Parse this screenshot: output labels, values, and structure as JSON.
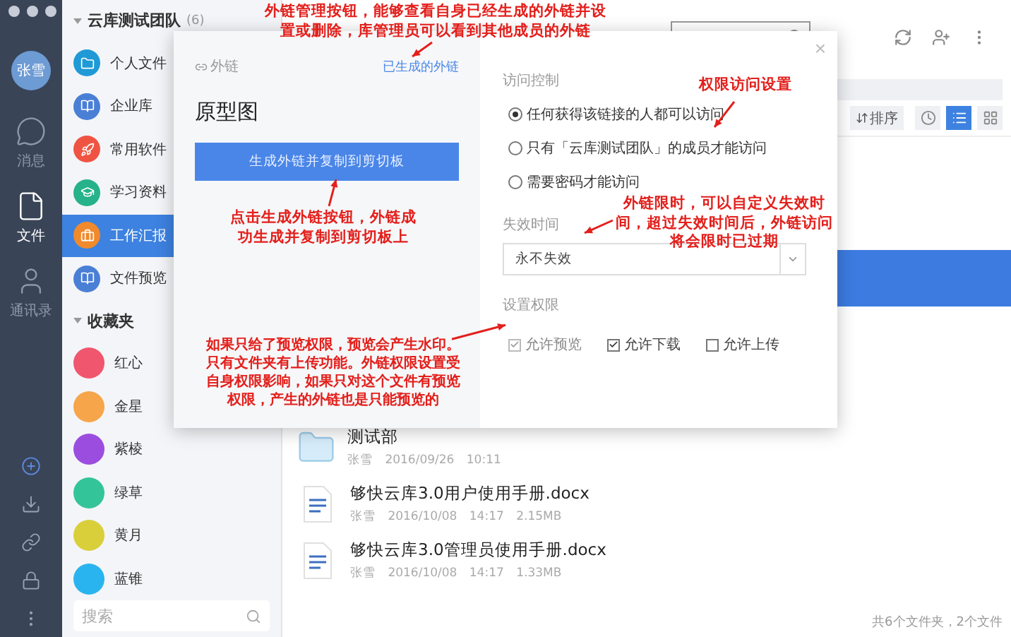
{
  "nav": {
    "avatar": "张雪",
    "items": [
      {
        "kind": "message",
        "label": "消息",
        "selected": false
      },
      {
        "kind": "file",
        "label": "文件",
        "selected": true
      },
      {
        "kind": "contacts",
        "label": "通讯录",
        "selected": false
      }
    ],
    "tools": [
      {
        "kind": "add"
      },
      {
        "kind": "download"
      },
      {
        "kind": "link"
      },
      {
        "kind": "lock"
      },
      {
        "kind": "more"
      }
    ]
  },
  "sidebar": {
    "team": {
      "name": "云库测试团队",
      "count": "(6)",
      "expanded": true
    },
    "libraries": [
      {
        "label": "个人文件",
        "color": "#1f9ad6",
        "kind": "folder",
        "selected": false
      },
      {
        "label": "企业库",
        "color": "#4a7fd6",
        "kind": "book",
        "selected": false
      },
      {
        "label": "常用软件",
        "color": "#ef5443",
        "kind": "rocket",
        "selected": false
      },
      {
        "label": "学习资料",
        "color": "#26b28a",
        "kind": "cap",
        "selected": false
      },
      {
        "label": "工作汇报",
        "color": "#f08a2c",
        "kind": "bag",
        "selected": true
      },
      {
        "label": "文件预览",
        "color": "#4a7fd6",
        "kind": "book",
        "selected": false
      }
    ],
    "favorites_title": "收藏夹",
    "favorites_expanded": true,
    "favorites": [
      {
        "label": "红心",
        "color": "#f0566e"
      },
      {
        "label": "金星",
        "color": "#f7a54a"
      },
      {
        "label": "紫棱",
        "color": "#9b4de0"
      },
      {
        "label": "绿草",
        "color": "#33c49a"
      },
      {
        "label": "黄月",
        "color": "#d9cf3a"
      },
      {
        "label": "蓝锥",
        "color": "#2ab4ef"
      }
    ],
    "search": {
      "placeholder": "搜索"
    }
  },
  "toolbar": {
    "sort": "排序",
    "views": [
      {
        "kind": "time",
        "selected": false
      },
      {
        "kind": "list",
        "selected": true
      },
      {
        "kind": "grid",
        "selected": false
      }
    ]
  },
  "files": [
    {
      "selected": false
    },
    {
      "selected": false
    },
    {
      "selected": true
    },
    {
      "selected": false
    },
    {
      "selected": false
    },
    {
      "selected": false,
      "kind": "folder",
      "name": "测试部",
      "owner": "张雪",
      "date": "2016/09/26 10:11"
    },
    {
      "selected": false,
      "kind": "doc",
      "name": "够快云库3.0用户使用手册.docx",
      "owner": "张雪",
      "date": "2016/10/08 14:17",
      "size": "2.15MB"
    },
    {
      "selected": false,
      "kind": "doc",
      "name": "够快云库3.0管理员使用手册.docx",
      "owner": "张雪",
      "date": "2016/10/08 14:17",
      "size": "1.33MB"
    }
  ],
  "footer": "共6个文件夹，2个文件",
  "dialog": {
    "tab": "外链",
    "manage_link": "已生成的外链",
    "file_name": "原型图",
    "generate_button": "生成外链并复制到剪切板",
    "close": "×",
    "access_title": "访问控制",
    "access_options": [
      {
        "label": "任何获得该链接的人都可以访问",
        "selected": true
      },
      {
        "label": "只有「云库测试团队」的成员才能访问",
        "selected": false
      },
      {
        "label": "需要密码才能访问",
        "selected": false
      }
    ],
    "expire_title": "失效时间",
    "expire_value": "永不失效",
    "permission_title": "设置权限",
    "permissions": [
      {
        "label": "允许预览",
        "checked": true,
        "disabled": true
      },
      {
        "label": "允许下载",
        "checked": true,
        "disabled": false
      },
      {
        "label": "允许上传",
        "checked": false,
        "disabled": false
      }
    ]
  },
  "annotations": [
    "外链管理按钮，能够查看自身已经生成的外链并设置或删除，库管理员可以看到其他成员的外链",
    "权限访问设置",
    "点击生成外链按钮，外链成功生成并复制到剪切板上",
    "外链限时，可以自定义失效时间，超过失效时间后，外链访问将会限时已过期",
    "如果只给了预览权限，预览会产生水印。只有文件夹有上传功能。外链权限设置受自身权限影响，如果只对这个文件有预览权限，产生的外链也是只能预览的"
  ]
}
